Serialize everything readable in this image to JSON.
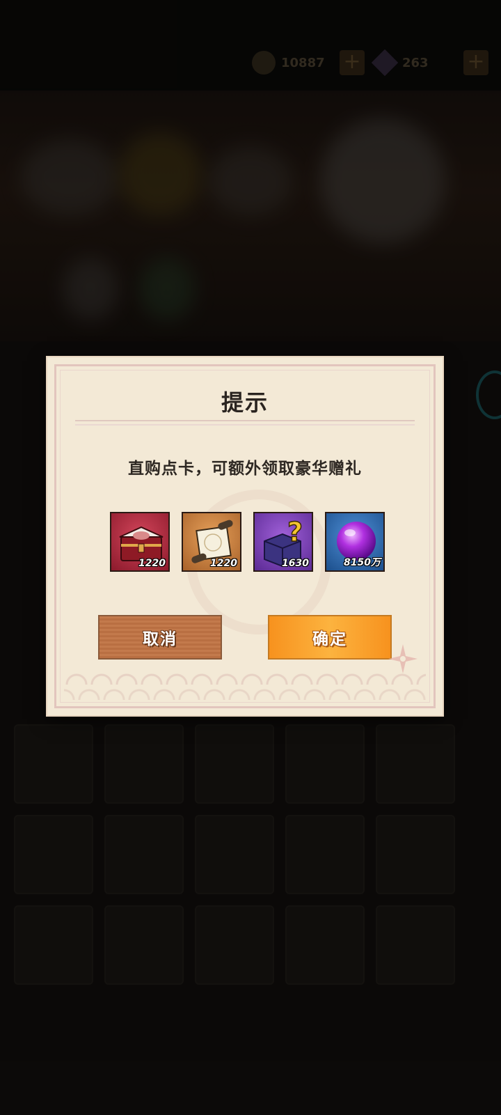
{
  "hud": {
    "coins": "10887",
    "gems": "263",
    "coin_icon": "coin-icon",
    "gem_icon": "gem-icon",
    "plus_label": "+"
  },
  "dialog": {
    "title": "提示",
    "message": "直购点卡，可额外领取豪华赠礼",
    "items": [
      {
        "icon": "treasure-chest-icon",
        "count": "1220",
        "rarity_color": "#b8283f"
      },
      {
        "icon": "scroll-icon",
        "count": "1220",
        "rarity_color": "#c4813f"
      },
      {
        "icon": "mystery-box-icon",
        "count": "1630",
        "rarity_color": "#7d42b8"
      },
      {
        "icon": "purple-orb-icon",
        "count": "8150万",
        "rarity_color": "#2f6fb5"
      }
    ],
    "cancel_label": "取消",
    "confirm_label": "确定"
  },
  "colors": {
    "dialog_bg": "#f3e9d6",
    "cancel_button": "#c37a4c",
    "confirm_button": "#fcb33f"
  }
}
